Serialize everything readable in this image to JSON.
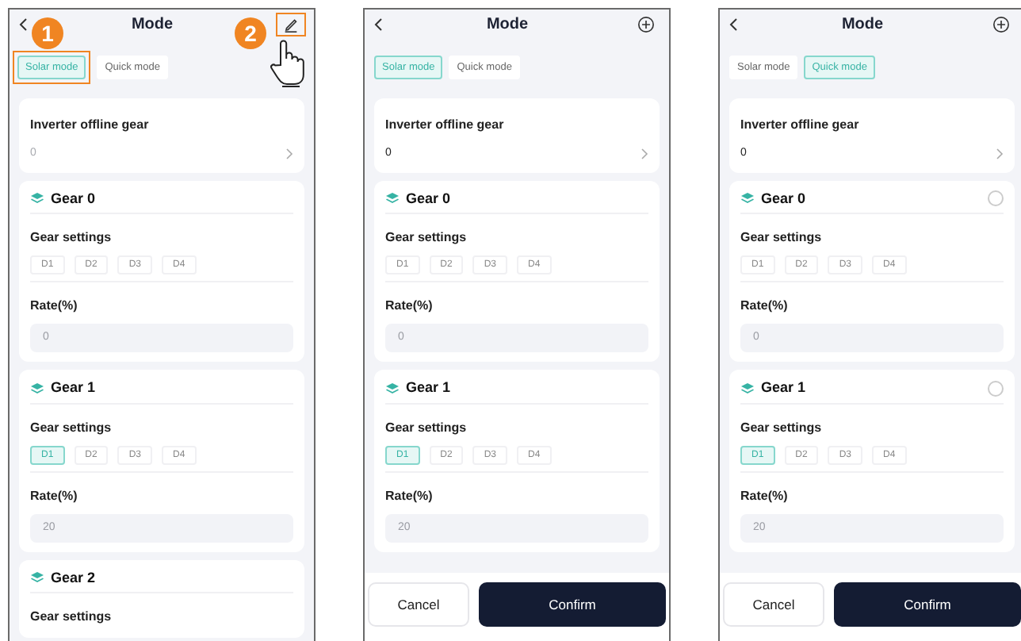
{
  "screens": [
    {
      "header": {
        "title": "Mode",
        "action": {
          "kind": "edit",
          "highlighted": true,
          "badge": "2",
          "hand_cursor": true
        }
      },
      "tabs": [
        {
          "label": "Solar mode",
          "selected": true,
          "highlighted": true,
          "badge": "1"
        },
        {
          "label": "Quick mode",
          "selected": false,
          "highlighted": false
        }
      ],
      "offline": {
        "label": "Inverter offline gear",
        "value": "0",
        "disabled": true
      },
      "gears": [
        {
          "title": "Gear 0",
          "settings_label": "Gear settings",
          "options": [
            {
              "label": "D1",
              "selected": false
            },
            {
              "label": "D2",
              "selected": false
            },
            {
              "label": "D3",
              "selected": false
            },
            {
              "label": "D4",
              "selected": false
            }
          ],
          "rate_label": "Rate(%)",
          "rate": "0"
        },
        {
          "title": "Gear 1",
          "settings_label": "Gear settings",
          "options": [
            {
              "label": "D1",
              "selected": true
            },
            {
              "label": "D2",
              "selected": false
            },
            {
              "label": "D3",
              "selected": false
            },
            {
              "label": "D4",
              "selected": false
            }
          ],
          "rate_label": "Rate(%)",
          "rate": "20"
        },
        {
          "title": "Gear 2",
          "settings_label": "Gear settings"
        }
      ]
    },
    {
      "header": {
        "title": "Mode",
        "action": {
          "kind": "add",
          "highlighted": false
        }
      },
      "tabs": [
        {
          "label": "Solar mode",
          "selected": true,
          "highlighted": false
        },
        {
          "label": "Quick mode",
          "selected": false,
          "highlighted": false
        }
      ],
      "offline": {
        "label": "Inverter offline gear",
        "value": "0",
        "disabled": false
      },
      "gears": [
        {
          "title": "Gear 0",
          "settings_label": "Gear settings",
          "options": [
            {
              "label": "D1",
              "selected": false
            },
            {
              "label": "D2",
              "selected": false
            },
            {
              "label": "D3",
              "selected": false
            },
            {
              "label": "D4",
              "selected": false
            }
          ],
          "rate_label": "Rate(%)",
          "rate": "0"
        },
        {
          "title": "Gear 1",
          "settings_label": "Gear settings",
          "options": [
            {
              "label": "D1",
              "selected": true
            },
            {
              "label": "D2",
              "selected": false
            },
            {
              "label": "D3",
              "selected": false
            },
            {
              "label": "D4",
              "selected": false
            }
          ],
          "rate_label": "Rate(%)",
          "rate": "20"
        }
      ],
      "buttons": [
        {
          "label": "Cancel",
          "kind": "secondary"
        },
        {
          "label": "Confirm",
          "kind": "primary"
        }
      ]
    },
    {
      "header": {
        "title": "Mode",
        "action": {
          "kind": "add",
          "highlighted": false
        }
      },
      "tabs": [
        {
          "label": "Solar mode",
          "selected": false,
          "highlighted": false
        },
        {
          "label": "Quick mode",
          "selected": true,
          "highlighted": false
        }
      ],
      "offline": {
        "label": "Inverter offline gear",
        "value": "0",
        "disabled": false
      },
      "gears": [
        {
          "title": "Gear 0",
          "selected": false,
          "settings_label": "Gear settings",
          "options": [
            {
              "label": "D1",
              "selected": false
            },
            {
              "label": "D2",
              "selected": false
            },
            {
              "label": "D3",
              "selected": false
            },
            {
              "label": "D4",
              "selected": false
            }
          ],
          "rate_label": "Rate(%)",
          "rate": "0"
        },
        {
          "title": "Gear 1",
          "selected": false,
          "settings_label": "Gear settings",
          "options": [
            {
              "label": "D1",
              "selected": true
            },
            {
              "label": "D2",
              "selected": false
            },
            {
              "label": "D3",
              "selected": false
            },
            {
              "label": "D4",
              "selected": false
            }
          ],
          "rate_label": "Rate(%)",
          "rate": "20"
        }
      ],
      "buttons": [
        {
          "label": "Cancel",
          "kind": "secondary"
        },
        {
          "label": "Confirm",
          "kind": "primary"
        }
      ]
    }
  ]
}
